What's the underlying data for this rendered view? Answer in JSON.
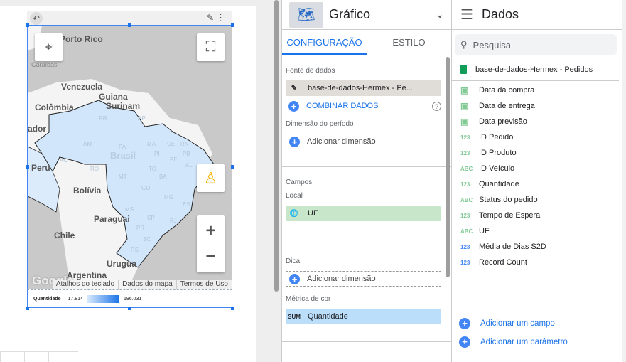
{
  "canvas": {
    "map": {
      "labels": {
        "porto_rico": "Porto Rico",
        "caraibas": "Caraíbas",
        "venezuela": "Venezuela",
        "guiana": "Guiana",
        "suriname": "Surinam",
        "colombia": "Colômbia",
        "equador": "ador",
        "peru": "Peru",
        "brasil": "Brasil",
        "bolivia": "Bolívia",
        "paraguai": "Paraguai",
        "chile": "Chile",
        "uruguai": "Urugua",
        "argentina": "Argentina"
      },
      "states": [
        "RR",
        "AP",
        "AM",
        "PA",
        "MA",
        "CE",
        "RN",
        "PB",
        "PE",
        "AL",
        "PI",
        "AC",
        "RO",
        "TO",
        "BA",
        "MT",
        "GO",
        "MG",
        "ES",
        "MS",
        "SP",
        "RJ",
        "PR",
        "SC",
        "RS"
      ],
      "google_logo": "Google",
      "attribution": [
        "Atalhos do teclado",
        "Dados do mapa",
        "Termos de Uso"
      ],
      "fill_color": "#d2e6fb"
    },
    "legend": {
      "title": "Quantidade",
      "min": "17.814",
      "max": "196.031",
      "color_min": "#d7e9fd",
      "color_max": "#1a73e8"
    }
  },
  "config": {
    "chart_type": "Gráfico",
    "tabs": [
      "CONFIGURAÇÃO",
      "ESTILO"
    ],
    "active_tab": "CONFIGURAÇÃO",
    "data_source_label": "Fonte de dados",
    "data_source": "base-de-dados-Hermex - Pe...",
    "blend": "COMBINAR DADOS",
    "period_label": "Dimensão do período",
    "add_dimension": "Adicionar dimensão",
    "fields_label": "Campos",
    "location_label": "Local",
    "location_field": "UF",
    "tooltip_label": "Dica",
    "color_metric_label": "Métrica de cor",
    "color_metric_agg": "SUM",
    "color_metric": "Quantidade"
  },
  "data_panel": {
    "title": "Dados",
    "search_placeholder": "Pesquisa",
    "source": "base-de-dados-Hermex - Pedidos",
    "fields": [
      {
        "type": "date",
        "label": "Data da compra"
      },
      {
        "type": "123",
        "label": "Data de entrega"
      },
      {
        "type": "date",
        "label": "Data previsão"
      },
      {
        "type": "123",
        "label": "ID Pedido"
      },
      {
        "type": "123",
        "label": "ID Produto"
      },
      {
        "type": "ABC",
        "label": "ID Veículo"
      },
      {
        "type": "123",
        "label": "Quantidade"
      },
      {
        "type": "ABC",
        "label": "Status do pedido"
      },
      {
        "type": "123",
        "label": "Tempo de Espera"
      },
      {
        "type": "ABC",
        "label": "UF"
      },
      {
        "type": "123",
        "label": "Média de Dias S2D"
      },
      {
        "type": "123",
        "label": "Record Count"
      }
    ],
    "add_field": "Adicionar um campo",
    "add_parameter": "Adicionar um parâmetro"
  }
}
